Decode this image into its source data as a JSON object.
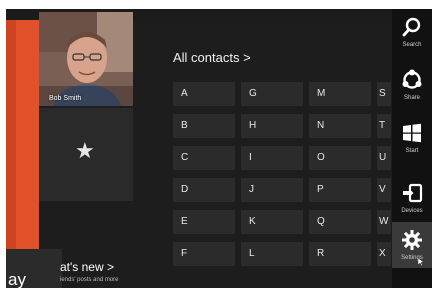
{
  "profile": {
    "name": "Bob Smith"
  },
  "contacts": {
    "header": "All contacts >",
    "columns": [
      [
        "A",
        "B",
        "C",
        "D",
        "E",
        "F"
      ],
      [
        "G",
        "H",
        "I",
        "J",
        "K",
        "L"
      ],
      [
        "M",
        "N",
        "O",
        "P",
        "Q",
        "R"
      ]
    ],
    "partial_column": [
      "S",
      "T",
      "U",
      "V",
      "W",
      "X"
    ]
  },
  "whats_new": {
    "fragment": "ay",
    "title": "at's new >",
    "subtitle": "iends' posts and more"
  },
  "charms": [
    {
      "icon": "search-icon",
      "label": "Search"
    },
    {
      "icon": "share-icon",
      "label": "Share"
    },
    {
      "icon": "windows-start-icon",
      "label": "Start"
    },
    {
      "icon": "devices-icon",
      "label": "Devices"
    },
    {
      "icon": "gear-icon",
      "label": "Settings",
      "selected": true
    }
  ],
  "colors": {
    "accent_orange": "#e2512a",
    "background": "#1d1d1d",
    "tile": "#2b2b2b",
    "charm_bar": "#111111"
  }
}
